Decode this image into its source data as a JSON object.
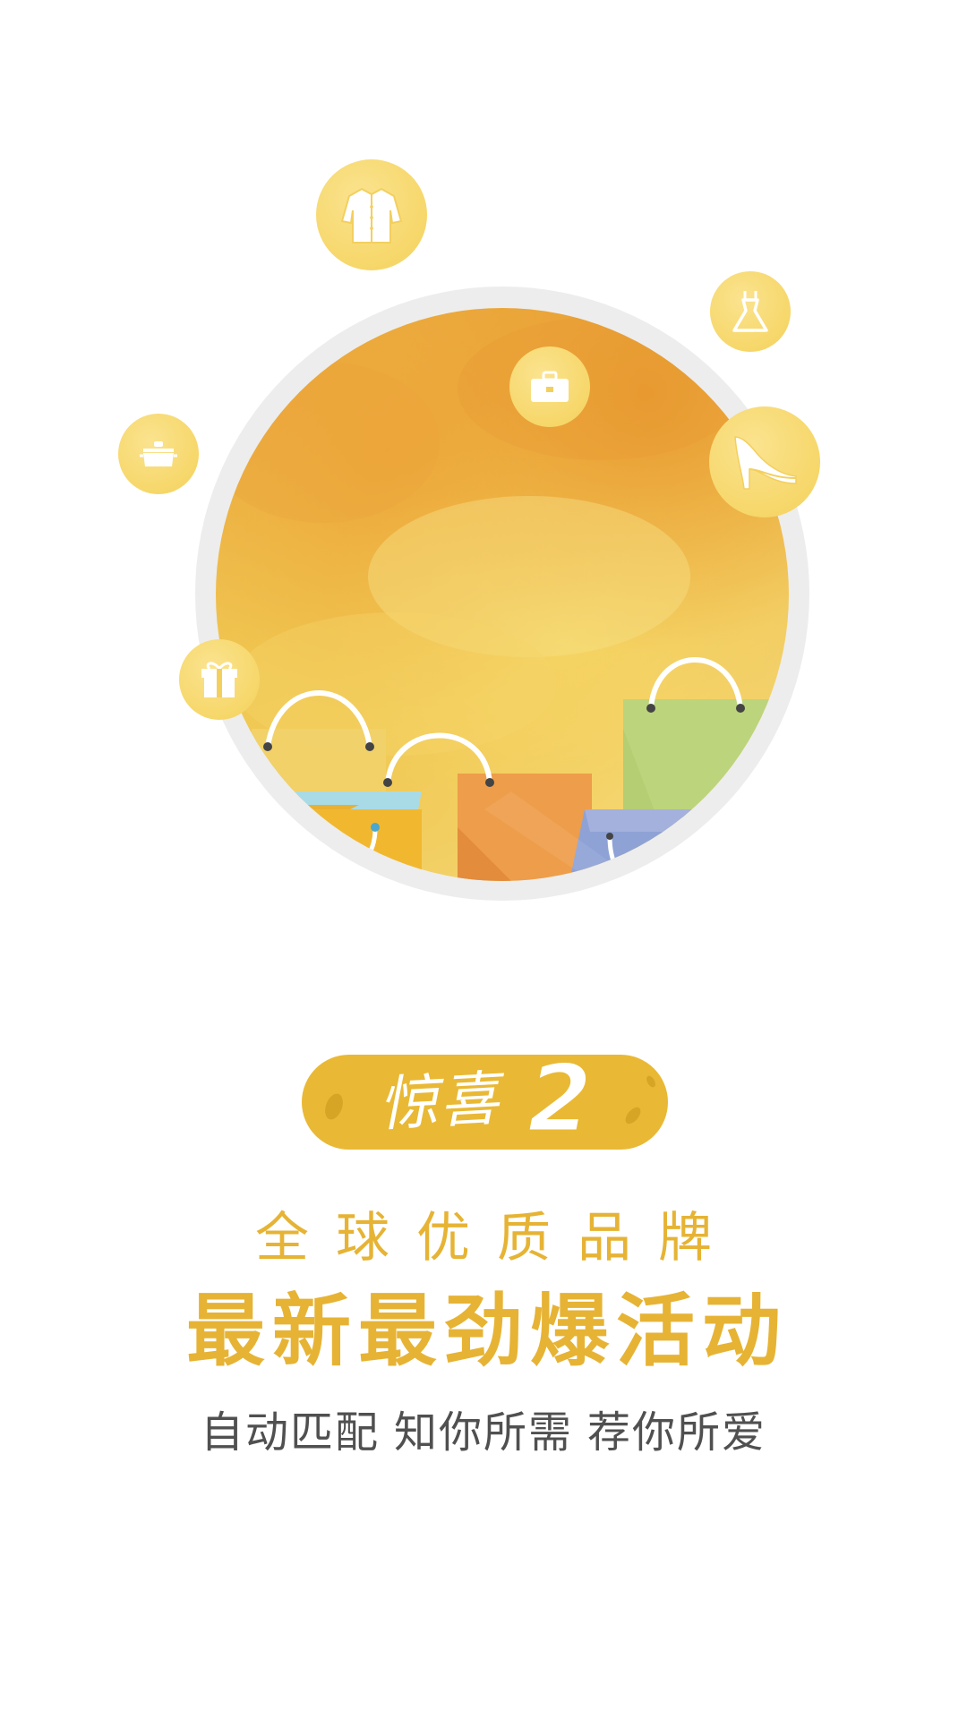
{
  "logo": {
    "text": "惊喜",
    "number": "2"
  },
  "headline": {
    "line1": "全球优质品牌",
    "line2": "最新最劲爆活动"
  },
  "tagline": {
    "part1": "自动匹配",
    "part2": "知你所需",
    "part3": "荐你所爱"
  },
  "icons": [
    "shirt-icon",
    "dress-icon",
    "briefcase-icon",
    "high-heel-icon",
    "pot-icon",
    "gift-icon",
    "shopping-bags-illustration"
  ],
  "colors": {
    "accent": "#e6b334",
    "badge": "#e9b935",
    "bubble": "#f6d76a",
    "tagline": "#505050",
    "ring": "#ededed"
  }
}
